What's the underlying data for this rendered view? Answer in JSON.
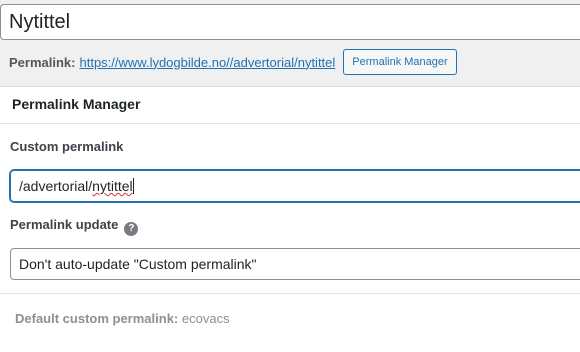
{
  "post": {
    "title": "Nytittel"
  },
  "permalink": {
    "label": "Permalink:",
    "url": "https://www.lydogbilde.no//advertorial/nytittel",
    "manager_button": "Permalink Manager"
  },
  "panel": {
    "heading": "Permalink Manager",
    "custom_permalink_label": "Custom permalink",
    "custom_permalink_prefix": "/advertorial/",
    "custom_permalink_word": "nytittel",
    "update_label": "Permalink update",
    "help_icon": "question-icon",
    "update_selected": "Don't auto-update \"Custom permalink\"",
    "default_label": "Default custom permalink:",
    "default_value": "ecovacs"
  }
}
